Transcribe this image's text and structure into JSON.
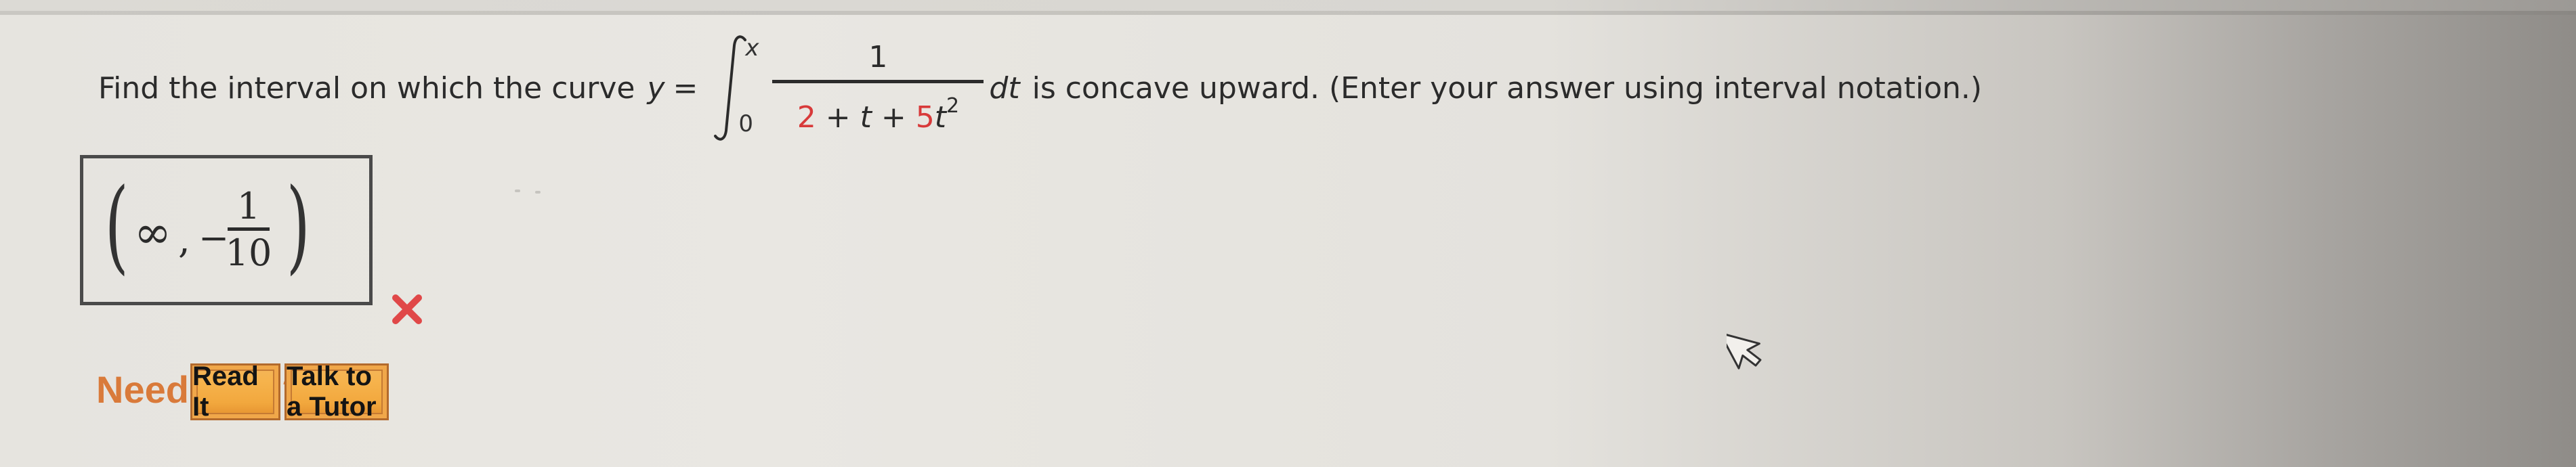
{
  "question": {
    "prefix": "Find the interval on which the curve",
    "y_var": "y",
    "equals": "=",
    "integral": {
      "upper_limit": "x",
      "lower_limit": "0",
      "numerator": "1",
      "denominator_parts": [
        {
          "text": "2",
          "randomized": true
        },
        {
          "text": " + ",
          "randomized": false
        },
        {
          "text": "t",
          "randomized": false,
          "italic": true
        },
        {
          "text": " + ",
          "randomized": false
        },
        {
          "text": "5",
          "randomized": true
        },
        {
          "text": "t",
          "randomized": false,
          "italic": true
        }
      ],
      "denominator_exponent": "2",
      "differential": "dt"
    },
    "suffix": "is concave upward. (Enter your answer using interval notation.)"
  },
  "answer": {
    "left_paren": "(",
    "infinity": "∞",
    "comma": ",",
    "minus": "−",
    "numerator": "1",
    "denominator": "10",
    "right_paren": ")",
    "status": "incorrect",
    "status_icon": "x-mark-icon"
  },
  "help": {
    "label": "Need Help?",
    "buttons": [
      {
        "label": "Read It"
      },
      {
        "label": "Talk to a Tutor"
      }
    ]
  },
  "colors": {
    "randomized_value": "#d83a3a",
    "need_help": "#d97a3a",
    "button_fill": "#f2a83e",
    "wrong_mark": "#e04848"
  }
}
